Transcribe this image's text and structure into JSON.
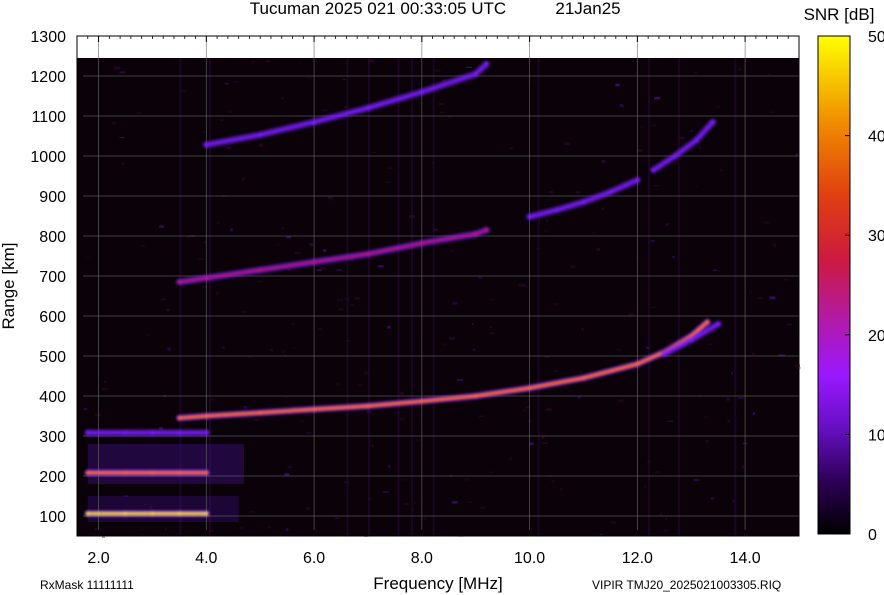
{
  "header": {
    "station_time": "Tucuman 2025 021 00:33:05 UTC",
    "date": "21Jan25"
  },
  "footer": {
    "rx_mask": "RxMask 11111111",
    "file_label": "VIPIR  TMJ20_2025021003305.RIQ"
  },
  "colors": {
    "background": "#0a0208",
    "grid": "#6a6a6a",
    "trace_low": "#7a1cff",
    "trace_mid": "#c01878",
    "trace_high": "#ff6a00",
    "trace_peak": "#ffd400"
  },
  "chart_data": {
    "type": "heatmap",
    "title": "Tucuman 2025 021 00:33:05 UTC",
    "xlabel": "Frequency [MHz]",
    "ylabel": "Range [km]",
    "xlim": [
      1.6,
      15.0
    ],
    "ylim": [
      50,
      1300
    ],
    "xticks": [
      "2.0",
      "4.0",
      "6.0",
      "8.0",
      "10.0",
      "12.0",
      "14.0"
    ],
    "xtick_values": [
      2,
      4,
      6,
      8,
      10,
      12,
      14
    ],
    "yticks": [
      "100",
      "200",
      "300",
      "400",
      "500",
      "600",
      "700",
      "800",
      "900",
      "1000",
      "1100",
      "1200",
      "1300"
    ],
    "ytick_values": [
      100,
      200,
      300,
      400,
      500,
      600,
      700,
      800,
      900,
      1000,
      1100,
      1200,
      1300
    ],
    "colorbar": {
      "label": "SNR [dB]",
      "range": [
        0,
        50
      ],
      "ticks": [
        "0",
        "10",
        "20",
        "30",
        "40",
        "50"
      ],
      "tick_values": [
        0,
        10,
        20,
        30,
        40,
        50
      ]
    },
    "grid": true,
    "series": [
      {
        "id": "E-layer-1hop",
        "snr": 45,
        "x": [
          1.8,
          2.5,
          3.0,
          3.5,
          4.0
        ],
        "y": [
          106,
          106,
          106,
          106,
          106
        ]
      },
      {
        "id": "E-layer-2hop",
        "snr": 30,
        "x": [
          1.8,
          2.5,
          3.0,
          3.5,
          4.0
        ],
        "y": [
          208,
          208,
          208,
          208,
          208
        ]
      },
      {
        "id": "E-layer-3hop",
        "snr": 14,
        "x": [
          1.8,
          2.5,
          3.0,
          3.5,
          4.0
        ],
        "y": [
          308,
          308,
          308,
          308,
          308
        ]
      },
      {
        "id": "F-layer-1hop",
        "snr": 30,
        "x": [
          3.5,
          4.0,
          5.0,
          6.0,
          7.0,
          8.0,
          9.0,
          10.0,
          11.0,
          12.0,
          12.5,
          13.0,
          13.3
        ],
        "y": [
          345,
          350,
          358,
          367,
          375,
          387,
          400,
          420,
          445,
          480,
          510,
          550,
          585
        ]
      },
      {
        "id": "F-layer-1hop-x",
        "snr": 16,
        "x": [
          12.5,
          13.0,
          13.5
        ],
        "y": [
          505,
          540,
          580
        ]
      },
      {
        "id": "F-layer-2hop",
        "snr": 28,
        "x": [
          3.5,
          4.0,
          5.0,
          6.0,
          7.0,
          8.0,
          9.0,
          9.2
        ],
        "y": [
          685,
          695,
          715,
          735,
          755,
          782,
          805,
          815
        ]
      },
      {
        "id": "F-layer-2hop-upper",
        "snr": 14,
        "x": [
          10.0,
          10.5,
          11.0,
          11.5,
          12.0
        ],
        "y": [
          848,
          865,
          885,
          910,
          940
        ]
      },
      {
        "id": "F-layer-3hop",
        "snr": 14,
        "x": [
          4.0,
          5.0,
          6.0,
          7.0,
          8.0,
          9.0,
          9.2
        ],
        "y": [
          1028,
          1053,
          1085,
          1120,
          1160,
          1205,
          1230
        ]
      },
      {
        "id": "F-layer-3hop-upper",
        "snr": 10,
        "x": [
          12.3,
          12.7,
          13.1,
          13.4
        ],
        "y": [
          965,
          1000,
          1040,
          1085
        ]
      }
    ]
  }
}
